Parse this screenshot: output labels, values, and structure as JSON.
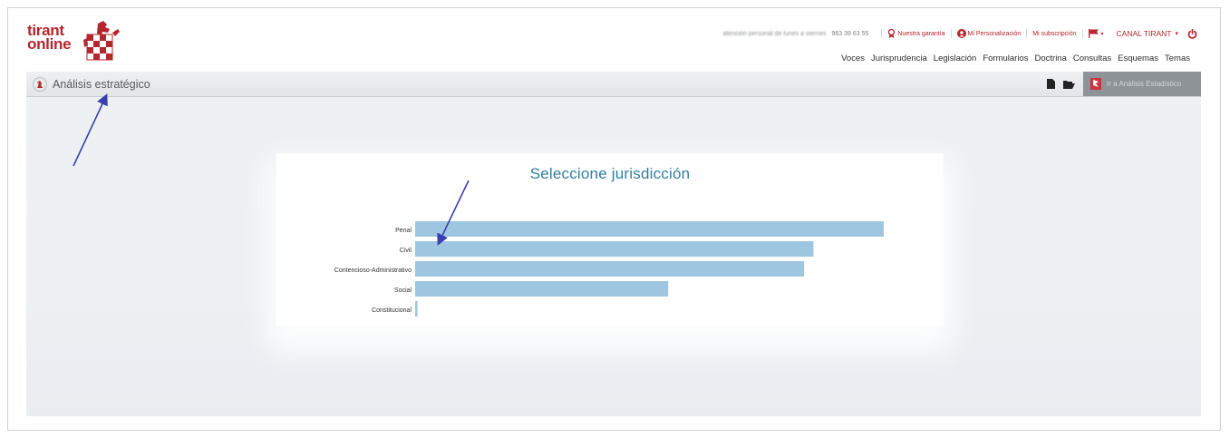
{
  "header": {
    "logo_line1": "tirant",
    "logo_line2": "online",
    "blurred_contact": "atención personal de lunes a viernes",
    "phone": "963 39 63 55",
    "links": {
      "garantia": "Nuestra garantía",
      "personalizacion": "Mi Personalización",
      "subscripcion": "Mi subscripción"
    },
    "canal": "CANAL TIRANT",
    "nav": [
      "Voces",
      "Jurisprudencia",
      "Legislación",
      "Formularios",
      "Doctrina",
      "Consultas",
      "Esquemas",
      "Temas"
    ]
  },
  "toolbar": {
    "title": "Análisis estratégico",
    "button": "Ir a Análisis Estadístico"
  },
  "chart_data": {
    "type": "bar",
    "orientation": "horizontal",
    "title": "Seleccione jurisdicción",
    "categories": [
      "Penal",
      "Civil",
      "Contencioso-Administrativo",
      "Social",
      "Constitucional"
    ],
    "values": [
      100,
      85,
      83,
      54,
      0.5
    ],
    "bar_color": "#9ec6e0"
  },
  "colors": {
    "brand": "#b5262d",
    "title_blue": "#2f7fa3",
    "annotation_arrow": "#3a3fb0"
  }
}
